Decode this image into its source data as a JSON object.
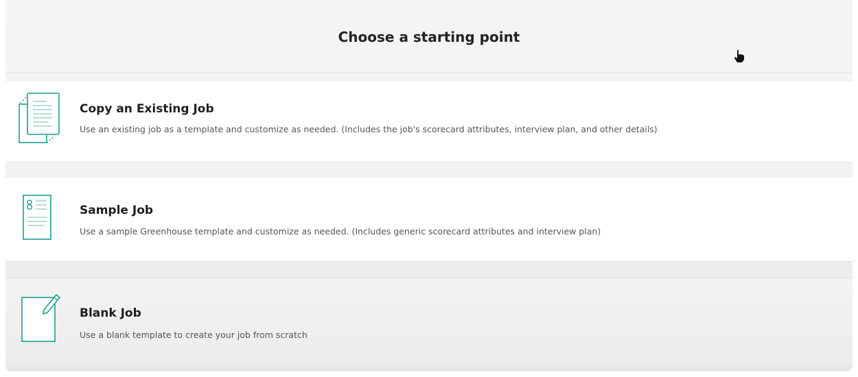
{
  "header": {
    "title": "Choose a starting point"
  },
  "options": [
    {
      "title": "Copy an Existing Job",
      "description": "Use an existing job as a template and customize as needed. (Includes the job's scorecard attributes, interview plan, and other details)",
      "icon": "copy-document-icon"
    },
    {
      "title": "Sample Job",
      "description": "Use a sample Greenhouse template and customize as needed. (Includes generic scorecard attributes and interview plan)",
      "icon": "template-list-icon"
    },
    {
      "title": "Blank Job",
      "description": "Use a blank template to create your job from scratch",
      "icon": "blank-page-pen-icon"
    }
  ],
  "colors": {
    "accent": "#1a9e8f",
    "title_text": "#1f1f1f",
    "description_text": "#555555"
  }
}
